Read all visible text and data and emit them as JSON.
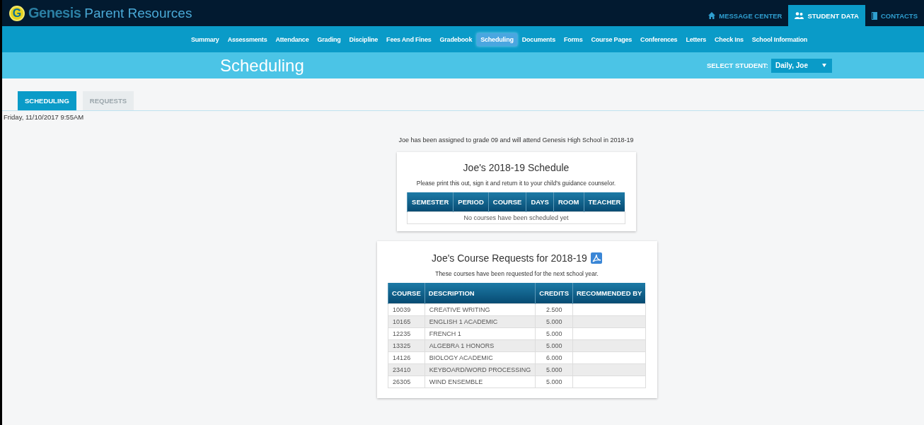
{
  "header": {
    "logo_mark": "G",
    "brand": "Genesis",
    "title": "Parent Resources",
    "tabs": [
      {
        "label": "MESSAGE CENTER",
        "kind": "home",
        "selected": false
      },
      {
        "label": "STUDENT DATA",
        "kind": "people",
        "selected": true
      },
      {
        "label": "CONTACTS",
        "kind": "book",
        "selected": false
      }
    ]
  },
  "nav": [
    {
      "label": "Summary",
      "selected": false
    },
    {
      "label": "Assessments",
      "selected": false
    },
    {
      "label": "Attendance",
      "selected": false
    },
    {
      "label": "Grading",
      "selected": false
    },
    {
      "label": "Discipline",
      "selected": false
    },
    {
      "label": "Fees And Fines",
      "selected": false
    },
    {
      "label": "Gradebook",
      "selected": false
    },
    {
      "label": "Scheduling",
      "selected": true
    },
    {
      "label": "Documents",
      "selected": false
    },
    {
      "label": "Forms",
      "selected": false
    },
    {
      "label": "Course Pages",
      "selected": false
    },
    {
      "label": "Conferences",
      "selected": false
    },
    {
      "label": "Letters",
      "selected": false
    },
    {
      "label": "Check Ins",
      "selected": false
    },
    {
      "label": "School Information",
      "selected": false
    }
  ],
  "page_title": "Scheduling",
  "student_select": {
    "label": "SELECT STUDENT:",
    "value": "Daily, Joe"
  },
  "tabs": [
    {
      "label": "SCHEDULING",
      "selected": true
    },
    {
      "label": "REQUESTS",
      "selected": false
    }
  ],
  "timestamp": "Friday, 11/10/2017 9:55AM",
  "assignment_note": "Joe has been assigned to grade 09 and will attend Genesis High School in 2018-19",
  "schedule": {
    "title": "Joe's 2018-19 Schedule",
    "note": "Please print this out, sign it and return it to your child's guidance counselor.",
    "columns": [
      "SEMESTER",
      "PERIOD",
      "COURSE",
      "DAYS",
      "ROOM",
      "TEACHER"
    ],
    "empty": "No courses have been scheduled yet"
  },
  "requests": {
    "title": "Joe's Course Requests for 2018-19",
    "note": "These courses have been requested for the next school year.",
    "columns": [
      "COURSE",
      "DESCRIPTION",
      "CREDITS",
      "RECOMMENDED BY"
    ],
    "rows": [
      [
        "10039",
        "CREATIVE WRITING",
        "2.500"
      ],
      [
        "10165",
        "ENGLISH 1 ACADEMIC",
        "5.000"
      ],
      [
        "12235",
        "FRENCH 1",
        "5.000"
      ],
      [
        "13325",
        "ALGEBRA 1 HONORS",
        "5.000"
      ],
      [
        "14126",
        "BIOLOGY ACADEMIC",
        "6.000"
      ],
      [
        "23410",
        "KEYBOARD/WORD PROCESSING",
        "5.000"
      ],
      [
        "26305",
        "WIND ENSEMBLE",
        "5.000"
      ]
    ]
  }
}
